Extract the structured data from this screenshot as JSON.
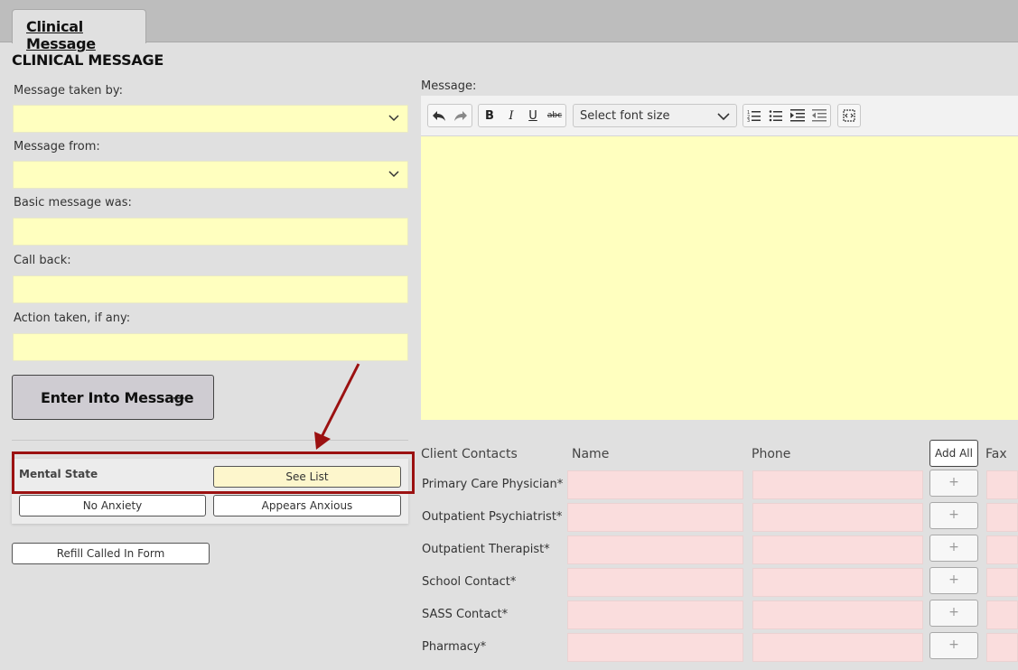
{
  "tabs": [
    {
      "label": "Clinical Message"
    }
  ],
  "page_title": "CLINICAL MESSAGE",
  "form": {
    "message_taken_by": {
      "label": "Message taken by:",
      "value": ""
    },
    "message_from": {
      "label": "Message from:",
      "value": ""
    },
    "basic_message": {
      "label": "Basic message was:",
      "value": ""
    },
    "call_back": {
      "label": "Call back:",
      "value": ""
    },
    "action_taken": {
      "label": "Action taken, if any:",
      "value": ""
    }
  },
  "enter_button": {
    "label": "Enter Into Message",
    "arrow": "→"
  },
  "mental_state": {
    "title": "Mental State",
    "see_list": "See List",
    "options": [
      "No Anxiety",
      "Appears Anxious"
    ]
  },
  "refill_button": "Refill Called In Form",
  "editor": {
    "label": "Message:",
    "font_size_placeholder": "Select font size",
    "toolbar_icons": [
      "undo-icon",
      "redo-icon",
      "bold-icon",
      "italic-icon",
      "underline-icon",
      "strikethrough-icon",
      "ordered-list-icon",
      "unordered-list-icon",
      "indent-icon",
      "outdent-icon",
      "source-icon"
    ]
  },
  "contacts": {
    "header": "Client Contacts",
    "columns": [
      "Name",
      "Phone",
      "Fax"
    ],
    "add_all": "Add All",
    "rows": [
      {
        "label": "Primary Care Physician*"
      },
      {
        "label": "Outpatient Psychiatrist*"
      },
      {
        "label": "Outpatient Therapist*"
      },
      {
        "label": "School Contact*"
      },
      {
        "label": "SASS Contact*"
      },
      {
        "label": "Pharmacy*"
      }
    ],
    "plus_symbol": "+"
  },
  "colors": {
    "field_yellow": "#ffffbf",
    "field_pink": "#fadddd",
    "highlight_red": "#9b1111",
    "button_gray": "#cfccd2"
  }
}
